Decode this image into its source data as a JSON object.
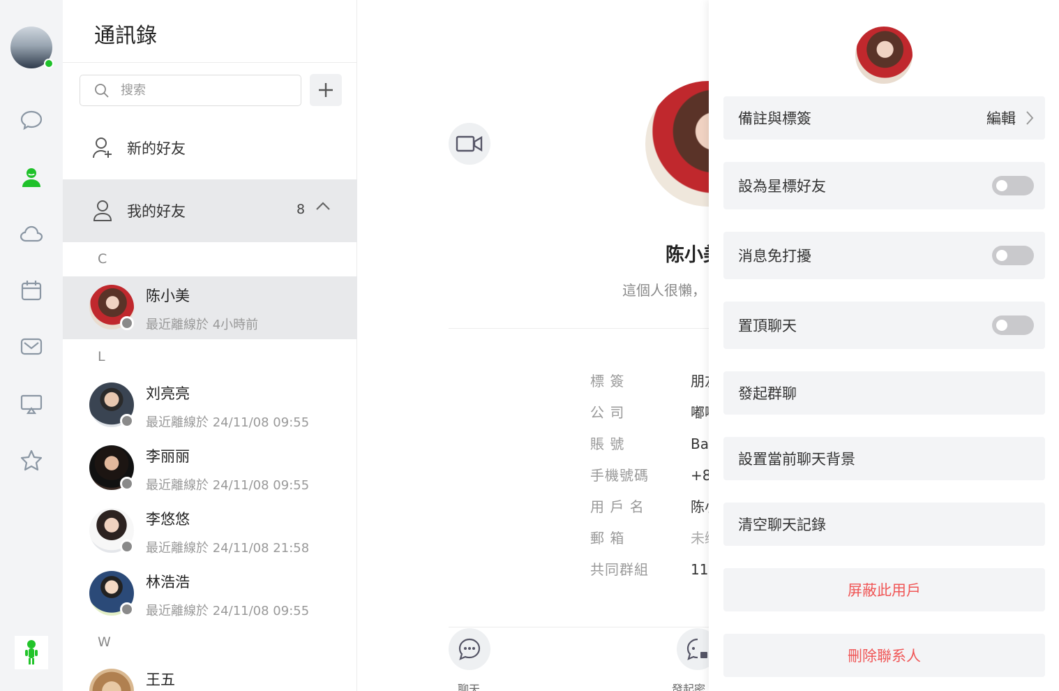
{
  "contacts": {
    "title": "通訊錄",
    "search_placeholder": "搜索",
    "new_friends_label": "新的好友",
    "my_friends_label": "我的好友",
    "my_friends_count": "8",
    "groups": [
      {
        "letter": "C",
        "items": [
          {
            "name": "陈小美",
            "status": "最近離線於 4小時前",
            "active": true
          }
        ]
      },
      {
        "letter": "L",
        "items": [
          {
            "name": "刘亮亮",
            "status": "最近離線於 24/11/08 09:55"
          },
          {
            "name": "李丽丽",
            "status": "最近離線於 24/11/08 09:55"
          },
          {
            "name": "李悠悠",
            "status": "最近離線於 24/11/08 21:58"
          },
          {
            "name": "林浩浩",
            "status": "最近離線於 24/11/08 09:55"
          }
        ]
      },
      {
        "letter": "W",
        "items": [
          {
            "name": "王五",
            "status": ""
          }
        ]
      }
    ]
  },
  "detail": {
    "name": "陈小美",
    "signature": "這個人很懶，",
    "fields": [
      {
        "label": "標 簽",
        "value": "朋友"
      },
      {
        "label": "公 司",
        "value": "嘟嘟"
      },
      {
        "label": "賬 號",
        "value": "Ba"
      },
      {
        "label": "手機號碼",
        "value": "+8"
      },
      {
        "label": "用 戶 名",
        "value": "陈小"
      },
      {
        "label": "郵 箱",
        "value": "未绑"
      },
      {
        "label": "共同群組",
        "value": "11"
      }
    ],
    "actions": [
      {
        "label": "聊天"
      },
      {
        "label": "發起密"
      }
    ]
  },
  "panel": {
    "remark_label": "備註與標簽",
    "remark_edit": "編輯",
    "star_label": "設為星標好友",
    "mute_label": "消息免打擾",
    "pin_label": "置頂聊天",
    "group_chat_label": "發起群聊",
    "bg_label": "設置當前聊天背景",
    "clear_label": "清空聊天記錄",
    "block_label": "屏蔽此用戶",
    "delete_label": "刪除聯系人"
  },
  "colors": {
    "accent": "#1fc12a",
    "danger": "#f05555",
    "offline": "#8a8a8a"
  }
}
